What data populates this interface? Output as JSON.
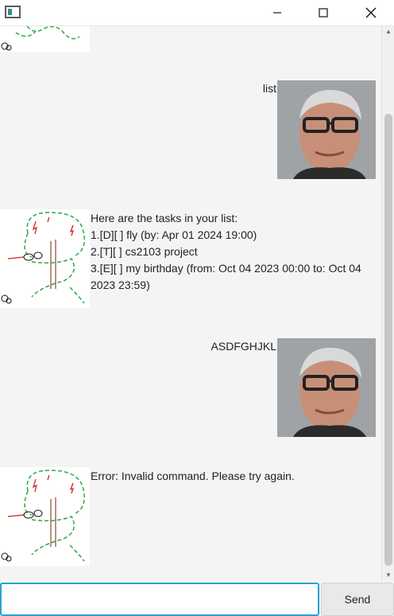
{
  "window": {
    "title": "",
    "controls": [
      "minimize-icon",
      "maximize-icon",
      "close-icon"
    ]
  },
  "chat": {
    "messages": [
      {
        "sender": "user",
        "text": "list"
      },
      {
        "sender": "bot",
        "lines": [
          "Here are the tasks in your list:",
          "1.[D][ ] fly (by: Apr 01 2024 19:00)",
          "2.[T][ ] cs2103 project",
          "3.[E][ ] my birthday (from: Oct 04 2023 00:00 to: Oct 04 2023 23:59)"
        ]
      },
      {
        "sender": "user",
        "text": "ASDFGHJKL"
      },
      {
        "sender": "bot",
        "lines": [
          "Error: Invalid command. Please try again."
        ]
      }
    ]
  },
  "input": {
    "value": "",
    "placeholder": ""
  },
  "send_button": {
    "label": "Send"
  }
}
